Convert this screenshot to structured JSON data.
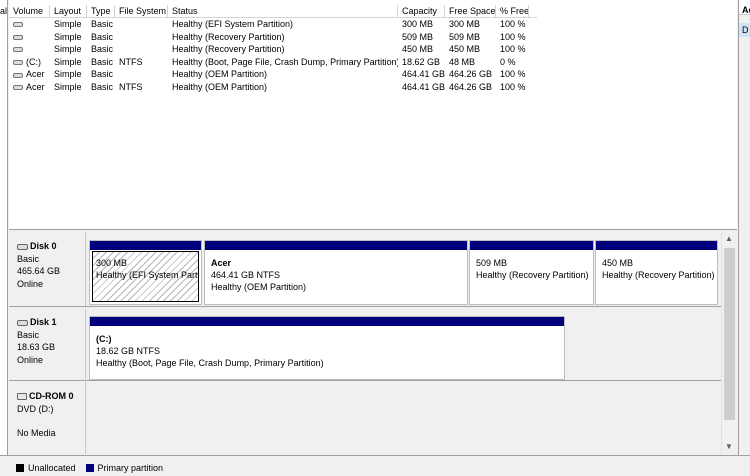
{
  "left_cut": "al",
  "right_panel": {
    "header": "Ac",
    "item": "D"
  },
  "volume_list": {
    "columns": [
      "Volume",
      "Layout",
      "Type",
      "File System",
      "Status",
      "Capacity",
      "Free Space",
      "% Free"
    ],
    "rows": [
      {
        "volume": "",
        "layout": "Simple",
        "type": "Basic",
        "fs": "",
        "status": "Healthy (EFI System Partition)",
        "capacity": "300 MB",
        "free": "300 MB",
        "pct": "100 %"
      },
      {
        "volume": "",
        "layout": "Simple",
        "type": "Basic",
        "fs": "",
        "status": "Healthy (Recovery Partition)",
        "capacity": "509 MB",
        "free": "509 MB",
        "pct": "100 %"
      },
      {
        "volume": "",
        "layout": "Simple",
        "type": "Basic",
        "fs": "",
        "status": "Healthy (Recovery Partition)",
        "capacity": "450 MB",
        "free": "450 MB",
        "pct": "100 %"
      },
      {
        "volume": "(C:)",
        "layout": "Simple",
        "type": "Basic",
        "fs": "NTFS",
        "status": "Healthy (Boot, Page File, Crash Dump, Primary Partition)",
        "capacity": "18.62 GB",
        "free": "48 MB",
        "pct": "0 %"
      },
      {
        "volume": "Acer",
        "layout": "Simple",
        "type": "Basic",
        "fs": "",
        "status": "Healthy (OEM Partition)",
        "capacity": "464.41 GB",
        "free": "464.26 GB",
        "pct": "100 %"
      },
      {
        "volume": "Acer",
        "layout": "Simple",
        "type": "Basic",
        "fs": "NTFS",
        "status": "Healthy (OEM Partition)",
        "capacity": "464.41 GB",
        "free": "464.26 GB",
        "pct": "100 %"
      }
    ]
  },
  "disks": [
    {
      "name": "Disk 0",
      "type": "Basic",
      "size": "465.64 GB",
      "state": "Online",
      "partitions": [
        {
          "title": "",
          "size": "300 MB",
          "status": "Healthy (EFI System Partiti"
        },
        {
          "title": "Acer",
          "size": "464.41 GB NTFS",
          "status": "Healthy (OEM Partition)"
        },
        {
          "title": "",
          "size": "509 MB",
          "status": "Healthy (Recovery Partition)"
        },
        {
          "title": "",
          "size": "450 MB",
          "status": "Healthy (Recovery Partition)"
        }
      ]
    },
    {
      "name": "Disk 1",
      "type": "Basic",
      "size": "18.63 GB",
      "state": "Online",
      "partitions": [
        {
          "title": "(C:)",
          "size": "18.62 GB NTFS",
          "status": "Healthy (Boot, Page File, Crash Dump, Primary Partition)"
        }
      ]
    },
    {
      "name": "CD-ROM 0",
      "type": "DVD (D:)",
      "size": "",
      "state": "No Media",
      "partitions": []
    }
  ],
  "legend": [
    {
      "label": "Unallocated",
      "color": "#000000"
    },
    {
      "label": "Primary partition",
      "color": "#00007c"
    }
  ]
}
